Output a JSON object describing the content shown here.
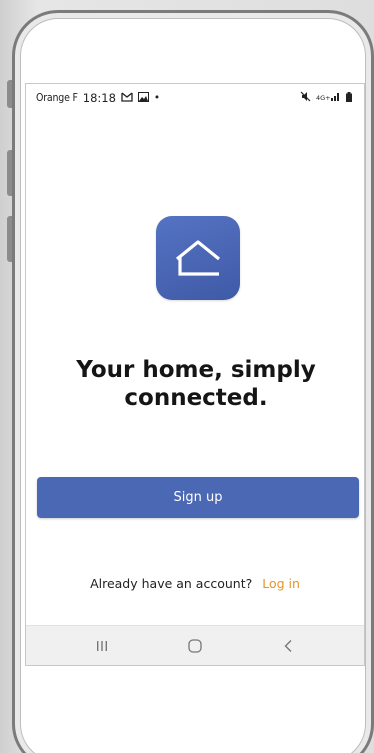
{
  "status_bar": {
    "carrier": "Orange F",
    "time": "18:18",
    "dot": "•",
    "network": "4G+",
    "icons": [
      "gmail-icon",
      "image-icon",
      "mute-icon",
      "signal-icon",
      "battery-icon"
    ]
  },
  "app": {
    "icon": "home-outline-icon",
    "headline_line1": "Your home, simply",
    "headline_line2": "connected.",
    "signup_label": "Sign up",
    "login_prompt": "Already have an account?",
    "login_label": "Log in"
  },
  "nav": {
    "icons": [
      "recent-apps-icon",
      "home-button-icon",
      "back-icon"
    ]
  },
  "colors": {
    "primary": "#4a68b3",
    "link": "#e69425",
    "icon_bg": "#4c67b6"
  }
}
